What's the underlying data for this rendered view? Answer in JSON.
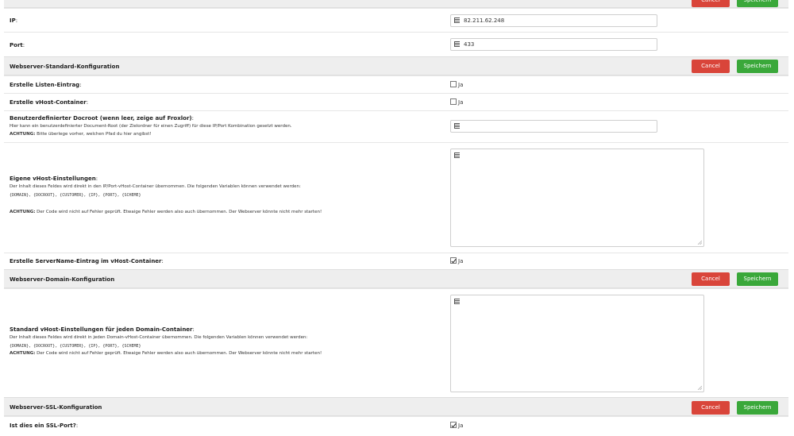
{
  "top": {
    "cancel_label": "Cancel",
    "save_label": "Speichern",
    "ip_label": "IP",
    "ip_value": "82.211.62.248",
    "port_label": "Port",
    "port_value": "433"
  },
  "standard": {
    "title": "Webserver-Standard-Konfiguration",
    "cancel_label": "Cancel",
    "save_label": "Speichern",
    "listen_label": "Erstelle Listen-Eintrag",
    "listen_opt": "Ja",
    "vhost_label": "Erstelle vHost-Container",
    "vhost_opt": "Ja",
    "docroot_label": "Benutzerdefinierter Docroot (wenn leer, zeige auf Froxlor)",
    "docroot_desc": "Hier kann ein benutzerdefinierter Document-Root (der Zielordner für einen Zugriff) für diese IP/Port Kombination gesetzt werden.",
    "docroot_warn_bold": "ACHTUNG:",
    "docroot_warn": " Bitte überlege vorher, welchen Pfad du hier angibst!",
    "own_vhost_label": "Eigene vHost-Einstellungen",
    "own_vhost_desc": "Der Inhalt dieses Feldes wird direkt in den IP/Port-vHost-Container übernommen. Die folgenden Variablen können verwendet werden:",
    "own_vhost_vars": "{DOMAIN}, {DOCROOT}, {CUSTOMER}, {IP}, {PORT}, {SCHEME}",
    "own_vhost_warn_bold": "ACHTUNG:",
    "own_vhost_warn": " Der Code wird nicht auf Fehler geprüft. Etwaige Fehler werden also auch übernommen. Der Webserver könnte nicht mehr starten!",
    "servername_label": "Erstelle ServerName-Eintrag im vHost-Container",
    "servername_opt": "Ja"
  },
  "domain": {
    "title": "Webserver-Domain-Konfiguration",
    "cancel_label": "Cancel",
    "save_label": "Speichern",
    "std_vhost_label": "Standard vHost-Einstellungen für jeden Domain-Container",
    "std_vhost_desc": "Der Inhalt dieses Feldes wird direkt in jeden Domain-vHost-Container übernommen. Die folgenden Variablen können verwendet werden:",
    "std_vhost_vars": "{DOMAIN}, {DOCROOT}, {CUSTOMER}, {IP}, {PORT}, {SCHEME}",
    "std_vhost_warn_bold": "ACHTUNG:",
    "std_vhost_warn": " Der Code wird nicht auf Fehler geprüft. Etwaige Fehler werden also auch übernommen. Der Webserver könnte nicht mehr starten!"
  },
  "ssl": {
    "title": "Webserver-SSL-Konfiguration",
    "cancel_label": "Cancel",
    "save_label": "Speichern",
    "is_ssl_label": "Ist dies ein SSL-Port?",
    "is_ssl_opt": "Ja"
  },
  "colors": {
    "cancel": "#d9453a",
    "save": "#3aa83a",
    "section_bg": "#eeeeee"
  }
}
